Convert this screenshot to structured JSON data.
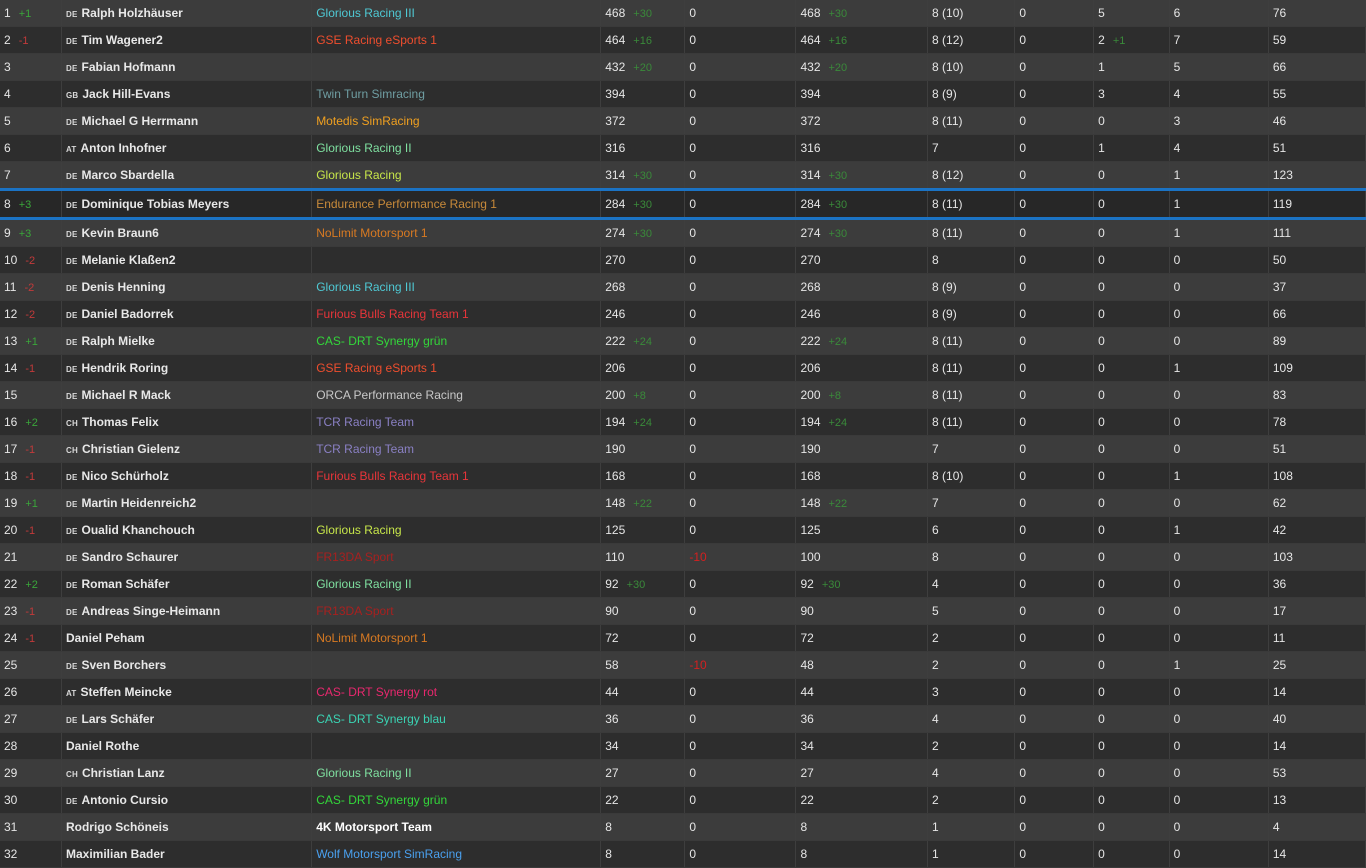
{
  "colors": {
    "row_odd": "#3c3c3c",
    "row_even": "#2d2d2d",
    "highlight_border": "#1b73c4",
    "delta_up": "#3aa63a",
    "delta_down": "#c23a3a",
    "gain": "#3a8a3a",
    "penalty_negative": "#d42020"
  },
  "rows": [
    {
      "pos": "1",
      "delta": "+1",
      "country": "DE",
      "driver": "Ralph Holzhäuser",
      "team": "Glorious Racing III",
      "team_color": "#4fc9d4",
      "points": "468",
      "points_gain": "+30",
      "penalty": "0",
      "total": "468",
      "total_gain": "+30",
      "races": "8 (10)",
      "c1": "0",
      "c2": "5",
      "c2_gain": "",
      "c3": "6",
      "c4": "76"
    },
    {
      "pos": "2",
      "delta": "-1",
      "country": "DE",
      "driver": "Tim Wagener2",
      "team": "GSE Racing eSports 1",
      "team_color": "#ee4e2e",
      "points": "464",
      "points_gain": "+16",
      "penalty": "0",
      "total": "464",
      "total_gain": "+16",
      "races": "8 (12)",
      "c1": "0",
      "c2": "2",
      "c2_gain": "+1",
      "c3": "7",
      "c4": "59"
    },
    {
      "pos": "3",
      "delta": "",
      "country": "DE",
      "driver": "Fabian Hofmann",
      "team": "",
      "team_color": "#ffffff",
      "points": "432",
      "points_gain": "+20",
      "penalty": "0",
      "total": "432",
      "total_gain": "+20",
      "races": "8 (10)",
      "c1": "0",
      "c2": "1",
      "c2_gain": "",
      "c3": "5",
      "c4": "66"
    },
    {
      "pos": "4",
      "delta": "",
      "country": "GB",
      "driver": "Jack Hill-Evans",
      "team": "Twin Turn Simracing",
      "team_color": "#6f9ea3",
      "points": "394",
      "points_gain": "",
      "penalty": "0",
      "total": "394",
      "total_gain": "",
      "races": "8 (9)",
      "c1": "0",
      "c2": "3",
      "c2_gain": "",
      "c3": "4",
      "c4": "55"
    },
    {
      "pos": "5",
      "delta": "",
      "country": "DE",
      "driver": "Michael G Herrmann",
      "team": "Motedis SimRacing",
      "team_color": "#f0a020",
      "points": "372",
      "points_gain": "",
      "penalty": "0",
      "total": "372",
      "total_gain": "",
      "races": "8 (11)",
      "c1": "0",
      "c2": "0",
      "c2_gain": "",
      "c3": "3",
      "c4": "46"
    },
    {
      "pos": "6",
      "delta": "",
      "country": "AT",
      "driver": "Anton Inhofner",
      "team": "Glorious Racing II",
      "team_color": "#7fe0a0",
      "points": "316",
      "points_gain": "",
      "penalty": "0",
      "total": "316",
      "total_gain": "",
      "races": "7",
      "c1": "0",
      "c2": "1",
      "c2_gain": "",
      "c3": "4",
      "c4": "51"
    },
    {
      "pos": "7",
      "delta": "",
      "country": "DE",
      "driver": "Marco Sbardella",
      "team": "Glorious Racing",
      "team_color": "#c7e64a",
      "points": "314",
      "points_gain": "+30",
      "penalty": "0",
      "total": "314",
      "total_gain": "+30",
      "races": "8 (12)",
      "c1": "0",
      "c2": "0",
      "c2_gain": "",
      "c3": "1",
      "c4": "123"
    },
    {
      "pos": "8",
      "delta": "+3",
      "country": "DE",
      "driver": "Dominique Tobias Meyers",
      "team": "Endurance Performance Racing 1",
      "team_color": "#c88a3a",
      "points": "284",
      "points_gain": "+30",
      "penalty": "0",
      "total": "284",
      "total_gain": "+30",
      "races": "8 (11)",
      "c1": "0",
      "c2": "0",
      "c2_gain": "",
      "c3": "1",
      "c4": "119",
      "highlight": true
    },
    {
      "pos": "9",
      "delta": "+3",
      "country": "DE",
      "driver": "Kevin Braun6",
      "team": "NoLimit Motorsport 1",
      "team_color": "#d87a22",
      "points": "274",
      "points_gain": "+30",
      "penalty": "0",
      "total": "274",
      "total_gain": "+30",
      "races": "8 (11)",
      "c1": "0",
      "c2": "0",
      "c2_gain": "",
      "c3": "1",
      "c4": "111"
    },
    {
      "pos": "10",
      "delta": "-2",
      "country": "DE",
      "driver": "Melanie Klaßen2",
      "team": "",
      "team_color": "#ffffff",
      "points": "270",
      "points_gain": "",
      "penalty": "0",
      "total": "270",
      "total_gain": "",
      "races": "8",
      "c1": "0",
      "c2": "0",
      "c2_gain": "",
      "c3": "0",
      "c4": "50"
    },
    {
      "pos": "11",
      "delta": "-2",
      "country": "DE",
      "driver": "Denis Henning",
      "team": "Glorious Racing III",
      "team_color": "#4fc9d4",
      "points": "268",
      "points_gain": "",
      "penalty": "0",
      "total": "268",
      "total_gain": "",
      "races": "8 (9)",
      "c1": "0",
      "c2": "0",
      "c2_gain": "",
      "c3": "0",
      "c4": "37"
    },
    {
      "pos": "12",
      "delta": "-2",
      "country": "DE",
      "driver": "Daniel Badorrek",
      "team": "Furious Bulls Racing Team 1",
      "team_color": "#e8353a",
      "points": "246",
      "points_gain": "",
      "penalty": "0",
      "total": "246",
      "total_gain": "",
      "races": "8 (9)",
      "c1": "0",
      "c2": "0",
      "c2_gain": "",
      "c3": "0",
      "c4": "66"
    },
    {
      "pos": "13",
      "delta": "+1",
      "country": "DE",
      "driver": "Ralph Mielke",
      "team": "CAS- DRT Synergy grün",
      "team_color": "#33d63a",
      "points": "222",
      "points_gain": "+24",
      "penalty": "0",
      "total": "222",
      "total_gain": "+24",
      "races": "8 (11)",
      "c1": "0",
      "c2": "0",
      "c2_gain": "",
      "c3": "0",
      "c4": "89"
    },
    {
      "pos": "14",
      "delta": "-1",
      "country": "DE",
      "driver": "Hendrik Roring",
      "team": "GSE Racing eSports 1",
      "team_color": "#ee4e2e",
      "points": "206",
      "points_gain": "",
      "penalty": "0",
      "total": "206",
      "total_gain": "",
      "races": "8 (11)",
      "c1": "0",
      "c2": "0",
      "c2_gain": "",
      "c3": "1",
      "c4": "109"
    },
    {
      "pos": "15",
      "delta": "",
      "country": "DE",
      "driver": "Michael R Mack",
      "team": "ORCA Performance Racing",
      "team_color": "#c8c8c8",
      "points": "200",
      "points_gain": "+8",
      "penalty": "0",
      "total": "200",
      "total_gain": "+8",
      "races": "8 (11)",
      "c1": "0",
      "c2": "0",
      "c2_gain": "",
      "c3": "0",
      "c4": "83"
    },
    {
      "pos": "16",
      "delta": "+2",
      "country": "CH",
      "driver": "Thomas Felix",
      "team": "TCR Racing Team",
      "team_color": "#8a80c4",
      "points": "194",
      "points_gain": "+24",
      "penalty": "0",
      "total": "194",
      "total_gain": "+24",
      "races": "8 (11)",
      "c1": "0",
      "c2": "0",
      "c2_gain": "",
      "c3": "0",
      "c4": "78"
    },
    {
      "pos": "17",
      "delta": "-1",
      "country": "CH",
      "driver": "Christian Gielenz",
      "team": "TCR Racing Team",
      "team_color": "#8a80c4",
      "points": "190",
      "points_gain": "",
      "penalty": "0",
      "total": "190",
      "total_gain": "",
      "races": "7",
      "c1": "0",
      "c2": "0",
      "c2_gain": "",
      "c3": "0",
      "c4": "51"
    },
    {
      "pos": "18",
      "delta": "-1",
      "country": "DE",
      "driver": "Nico Schürholz",
      "team": "Furious Bulls Racing Team 1",
      "team_color": "#e8353a",
      "points": "168",
      "points_gain": "",
      "penalty": "0",
      "total": "168",
      "total_gain": "",
      "races": "8 (10)",
      "c1": "0",
      "c2": "0",
      "c2_gain": "",
      "c3": "1",
      "c4": "108"
    },
    {
      "pos": "19",
      "delta": "+1",
      "country": "DE",
      "driver": "Martin Heidenreich2",
      "team": "",
      "team_color": "#ffffff",
      "points": "148",
      "points_gain": "+22",
      "penalty": "0",
      "total": "148",
      "total_gain": "+22",
      "races": "7",
      "c1": "0",
      "c2": "0",
      "c2_gain": "",
      "c3": "0",
      "c4": "62"
    },
    {
      "pos": "20",
      "delta": "-1",
      "country": "DE",
      "driver": "Oualid Khanchouch",
      "team": "Glorious Racing",
      "team_color": "#c7e64a",
      "points": "125",
      "points_gain": "",
      "penalty": "0",
      "total": "125",
      "total_gain": "",
      "races": "6",
      "c1": "0",
      "c2": "0",
      "c2_gain": "",
      "c3": "1",
      "c4": "42"
    },
    {
      "pos": "21",
      "delta": "",
      "country": "DE",
      "driver": "Sandro Schaurer",
      "team": "FR13DA Sport",
      "team_color": "#a8201f",
      "points": "110",
      "points_gain": "",
      "penalty": "-10",
      "total": "100",
      "total_gain": "",
      "races": "8",
      "c1": "0",
      "c2": "0",
      "c2_gain": "",
      "c3": "0",
      "c4": "103"
    },
    {
      "pos": "22",
      "delta": "+2",
      "country": "DE",
      "driver": "Roman Schäfer",
      "team": "Glorious Racing II",
      "team_color": "#7fe0a0",
      "points": "92",
      "points_gain": "+30",
      "penalty": "0",
      "total": "92",
      "total_gain": "+30",
      "races": "4",
      "c1": "0",
      "c2": "0",
      "c2_gain": "",
      "c3": "0",
      "c4": "36"
    },
    {
      "pos": "23",
      "delta": "-1",
      "country": "DE",
      "driver": "Andreas Singe-Heimann",
      "team": "FR13DA Sport",
      "team_color": "#a8201f",
      "points": "90",
      "points_gain": "",
      "penalty": "0",
      "total": "90",
      "total_gain": "",
      "races": "5",
      "c1": "0",
      "c2": "0",
      "c2_gain": "",
      "c3": "0",
      "c4": "17"
    },
    {
      "pos": "24",
      "delta": "-1",
      "country": "",
      "driver": "Daniel Peham",
      "team": "NoLimit Motorsport 1",
      "team_color": "#d87a22",
      "points": "72",
      "points_gain": "",
      "penalty": "0",
      "total": "72",
      "total_gain": "",
      "races": "2",
      "c1": "0",
      "c2": "0",
      "c2_gain": "",
      "c3": "0",
      "c4": "11"
    },
    {
      "pos": "25",
      "delta": "",
      "country": "DE",
      "driver": "Sven Borchers",
      "team": "",
      "team_color": "#ffffff",
      "points": "58",
      "points_gain": "",
      "penalty": "-10",
      "total": "48",
      "total_gain": "",
      "races": "2",
      "c1": "0",
      "c2": "0",
      "c2_gain": "",
      "c3": "1",
      "c4": "25"
    },
    {
      "pos": "26",
      "delta": "",
      "country": "AT",
      "driver": "Steffen Meincke",
      "team": "CAS- DRT Synergy rot",
      "team_color": "#e8286e",
      "points": "44",
      "points_gain": "",
      "penalty": "0",
      "total": "44",
      "total_gain": "",
      "races": "3",
      "c1": "0",
      "c2": "0",
      "c2_gain": "",
      "c3": "0",
      "c4": "14"
    },
    {
      "pos": "27",
      "delta": "",
      "country": "DE",
      "driver": "Lars Schäfer",
      "team": "CAS- DRT Synergy blau",
      "team_color": "#3ad4b4",
      "points": "36",
      "points_gain": "",
      "penalty": "0",
      "total": "36",
      "total_gain": "",
      "races": "4",
      "c1": "0",
      "c2": "0",
      "c2_gain": "",
      "c3": "0",
      "c4": "40"
    },
    {
      "pos": "28",
      "delta": "",
      "country": "",
      "driver": "Daniel Rothe",
      "team": "",
      "team_color": "#ffffff",
      "points": "34",
      "points_gain": "",
      "penalty": "0",
      "total": "34",
      "total_gain": "",
      "races": "2",
      "c1": "0",
      "c2": "0",
      "c2_gain": "",
      "c3": "0",
      "c4": "14"
    },
    {
      "pos": "29",
      "delta": "",
      "country": "CH",
      "driver": "Christian Lanz",
      "team": "Glorious Racing II",
      "team_color": "#7fe0a0",
      "points": "27",
      "points_gain": "",
      "penalty": "0",
      "total": "27",
      "total_gain": "",
      "races": "4",
      "c1": "0",
      "c2": "0",
      "c2_gain": "",
      "c3": "0",
      "c4": "53"
    },
    {
      "pos": "30",
      "delta": "",
      "country": "DE",
      "driver": "Antonio Cursio",
      "team": "CAS- DRT Synergy grün",
      "team_color": "#33d63a",
      "points": "22",
      "points_gain": "",
      "penalty": "0",
      "total": "22",
      "total_gain": "",
      "races": "2",
      "c1": "0",
      "c2": "0",
      "c2_gain": "",
      "c3": "0",
      "c4": "13"
    },
    {
      "pos": "31",
      "delta": "",
      "country": "",
      "driver": "Rodrigo Schöneis",
      "team": "4K Motorsport Team",
      "team_color": "#ffffff",
      "team_bold": true,
      "points": "8",
      "points_gain": "",
      "penalty": "0",
      "total": "8",
      "total_gain": "",
      "races": "1",
      "c1": "0",
      "c2": "0",
      "c2_gain": "",
      "c3": "0",
      "c4": "4"
    },
    {
      "pos": "32",
      "delta": "",
      "country": "",
      "driver": "Maximilian Bader",
      "team": "Wolf Motorsport SimRacing",
      "team_color": "#4aa0ee",
      "points": "8",
      "points_gain": "",
      "penalty": "0",
      "total": "8",
      "total_gain": "",
      "races": "1",
      "c1": "0",
      "c2": "0",
      "c2_gain": "",
      "c3": "0",
      "c4": "14"
    }
  ]
}
